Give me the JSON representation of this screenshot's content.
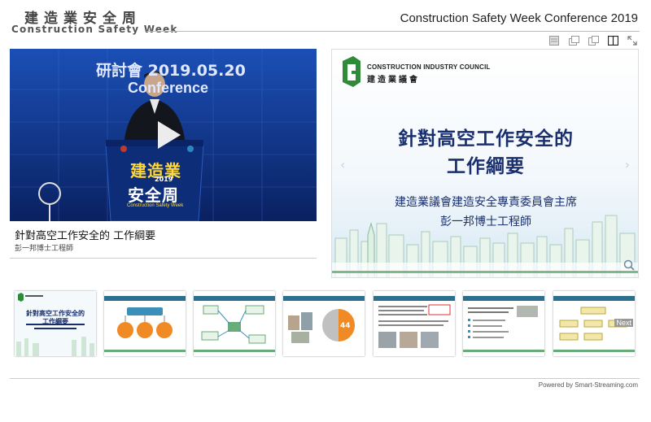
{
  "header": {
    "logo_zh": "建造業安全周",
    "logo_en": "Construction Safety Week",
    "conference_title": "Construction Safety Week Conference 2019"
  },
  "toolbar": [
    "layout-slide-icon",
    "layout-pip-icon",
    "layout-side-icon",
    "layout-split-icon",
    "fullscreen-icon"
  ],
  "video": {
    "banner_text": "研討會 2019.05.20",
    "banner_sub": "Conference",
    "podium_line1": "建造業",
    "podium_line2": "2019",
    "podium_line3": "安全周",
    "podium_line4": "Construction Safety Week"
  },
  "talk": {
    "title": "針對高空工作安全的 工作綱要",
    "speaker": "彭一邦博士工程師"
  },
  "slide": {
    "org_en": "CONSTRUCTION INDUSTRY COUNCIL",
    "org_zh": "建造業議會",
    "title_line1": "針對高空工作安全的",
    "title_line2": "工作綱要",
    "subtitle_line1": "建造業議會建造安全專責委員會主席",
    "subtitle_line2": "彭一邦博士工程師"
  },
  "thumbnails": {
    "t1_title1": "針對高空工作安全的",
    "t1_title2": "工作綱要",
    "t4_value": "44",
    "t7_next": "Next"
  },
  "footer": {
    "powered_by": "Powered by Smart-Streaming.com"
  },
  "colors": {
    "slide_title": "#1a2f6e",
    "video_bg": "#0c2a7a",
    "cic_green": "#5aa832"
  }
}
